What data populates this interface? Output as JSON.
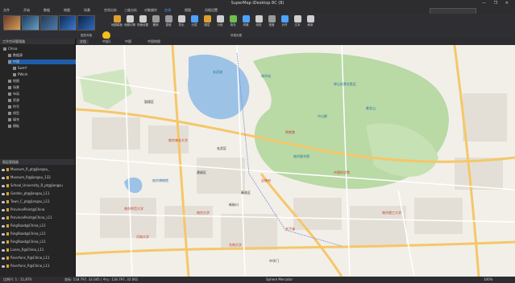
{
  "window": {
    "title": "SuperMap iDesktop 8C (8)",
    "controls": "— ❐ ✕"
  },
  "menu": {
    "items": [
      "文件",
      "开始",
      "数据",
      "地图",
      "场景",
      "空间分析",
      "三维分析",
      "对象操作",
      "在线",
      "视图",
      "风格设置"
    ],
    "active_index": 8
  },
  "ribbon": {
    "buttons": [
      "地图模板",
      "地图切换",
      "快速设置",
      "撤销",
      "重做",
      "导出",
      "分层",
      "图层",
      "分段",
      "填充",
      "风格",
      "线型",
      "宽度",
      "对齐",
      "文本",
      "刷新"
    ],
    "group_labels": [
      "图层风格",
      "风格设置"
    ]
  },
  "left_panel": {
    "workspace_header": "工作空间管理器",
    "tree": [
      {
        "label": "China",
        "level": 0
      },
      {
        "label": "数据源",
        "level": 1
      },
      {
        "label": "中国",
        "level": 1
      },
      {
        "label": "Swmf",
        "level": 2
      },
      {
        "label": "PWork",
        "level": 2
      },
      {
        "label": "地图",
        "level": 1
      },
      {
        "label": "场景",
        "level": 1
      },
      {
        "label": "布局",
        "level": 1
      },
      {
        "label": "资源",
        "level": 1
      },
      {
        "label": "符号",
        "level": 1
      },
      {
        "label": "线型",
        "level": 1
      },
      {
        "label": "填充",
        "level": 1
      },
      {
        "label": "模板",
        "level": 1
      }
    ],
    "selected_index": 2,
    "layers_header": "图层管理器",
    "layers": [
      "Museum_R_pt@Jiangsu_",
      "Museum_R@Jiangsu_132",
      "School_University_R_pt@Jiangsu",
      "Garden_pt@Jiangsu_L11",
      "Town_C_pt@Jiangsu_L11",
      "ProvincePoint@China",
      "ProvincePoint@China_L11",
      "RingRoad@China_L11",
      "RingRoad@China_L11",
      "RingRoad@China_L11",
      "Lanes_R@China_L11",
      "Riverfunc_R@China_L11",
      "Riverfunc_R@China_L11"
    ]
  },
  "map_tabs": [
    "文档",
    "中国1",
    "中国",
    "中国地图"
  ],
  "map_labels": [
    "鼓楼区",
    "玄武区",
    "秦淮区",
    "建邺区",
    "南京林业大学",
    "东南大学",
    "南京大学",
    "南京博物院",
    "钟山风景名胜区",
    "中山陵",
    "明孝陵",
    "紫金山",
    "南京师范大学",
    "河海大学",
    "南京图书馆",
    "总统府",
    "新街口",
    "夫子庙",
    "南京站",
    "玄武湖",
    "中华门",
    "中国科学院",
    "南京理工大学"
  ],
  "status": {
    "scale": "比例尺: 1 : 11,870",
    "coords": "坐标: 118.797, 32.045 | 中心: 118.797, 32.061",
    "crs": "Sphere Mercator",
    "zoom": "100%"
  }
}
